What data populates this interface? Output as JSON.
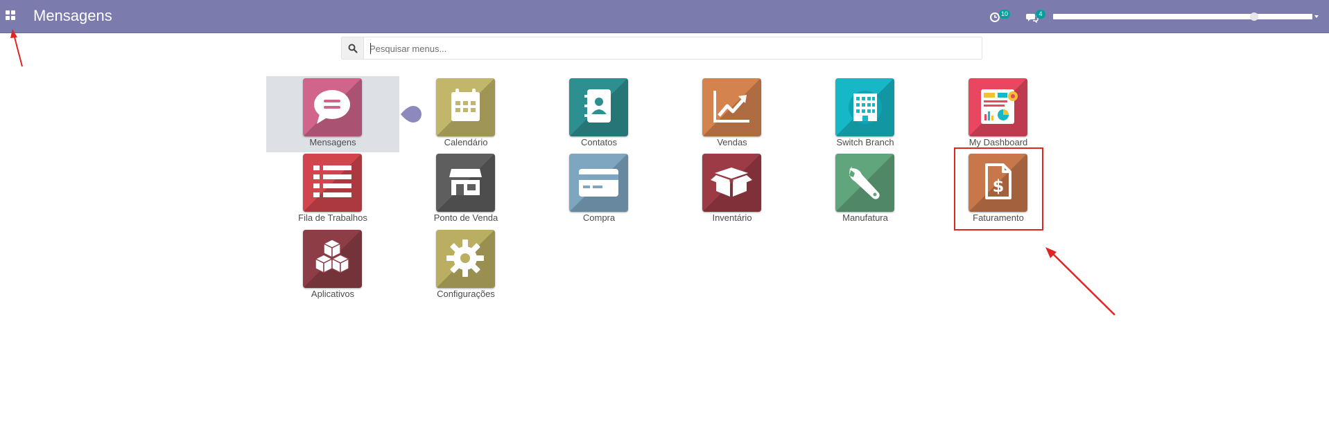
{
  "topbar": {
    "title": "Mensagens",
    "activity_count": "10",
    "messages_count": "4",
    "bg_color": "#7c7bad"
  },
  "search": {
    "placeholder": "Pesquisar menus...",
    "icon": "search-icon"
  },
  "apps": [
    {
      "label": "Mensagens",
      "icon": "chat-bubble-icon",
      "color": "#d0648b",
      "selected": true
    },
    {
      "label": "Calendário",
      "icon": "calendar-icon",
      "color": "#c2b66a"
    },
    {
      "label": "Contatos",
      "icon": "address-book-icon",
      "color": "#2e8f91"
    },
    {
      "label": "Vendas",
      "icon": "chart-trend-icon",
      "color": "#d4834f"
    },
    {
      "label": "Switch Branch",
      "icon": "building-icon",
      "color": "#16b7c6"
    },
    {
      "label": "My Dashboard",
      "icon": "dashboard-icon",
      "color": "#e8475f"
    },
    {
      "label": "Fila de Trabalhos",
      "icon": "list-icon",
      "color": "#d2454d"
    },
    {
      "label": "Ponto de Venda",
      "icon": "store-icon",
      "color": "#5e5e5e"
    },
    {
      "label": "Compra",
      "icon": "credit-card-icon",
      "color": "#7ea6c0"
    },
    {
      "label": "Inventário",
      "icon": "box-icon",
      "color": "#9c3b45"
    },
    {
      "label": "Manufatura",
      "icon": "wrench-icon",
      "color": "#61a57c"
    },
    {
      "label": "Faturamento",
      "icon": "invoice-icon",
      "color": "#c7774a",
      "highlighted": true
    },
    {
      "label": "Aplicativos",
      "icon": "cubes-icon",
      "color": "#8d3d46"
    },
    {
      "label": "Configurações",
      "icon": "gear-icon",
      "color": "#b9ae62"
    }
  ],
  "annotations": {
    "arrow_color": "#e02424"
  }
}
